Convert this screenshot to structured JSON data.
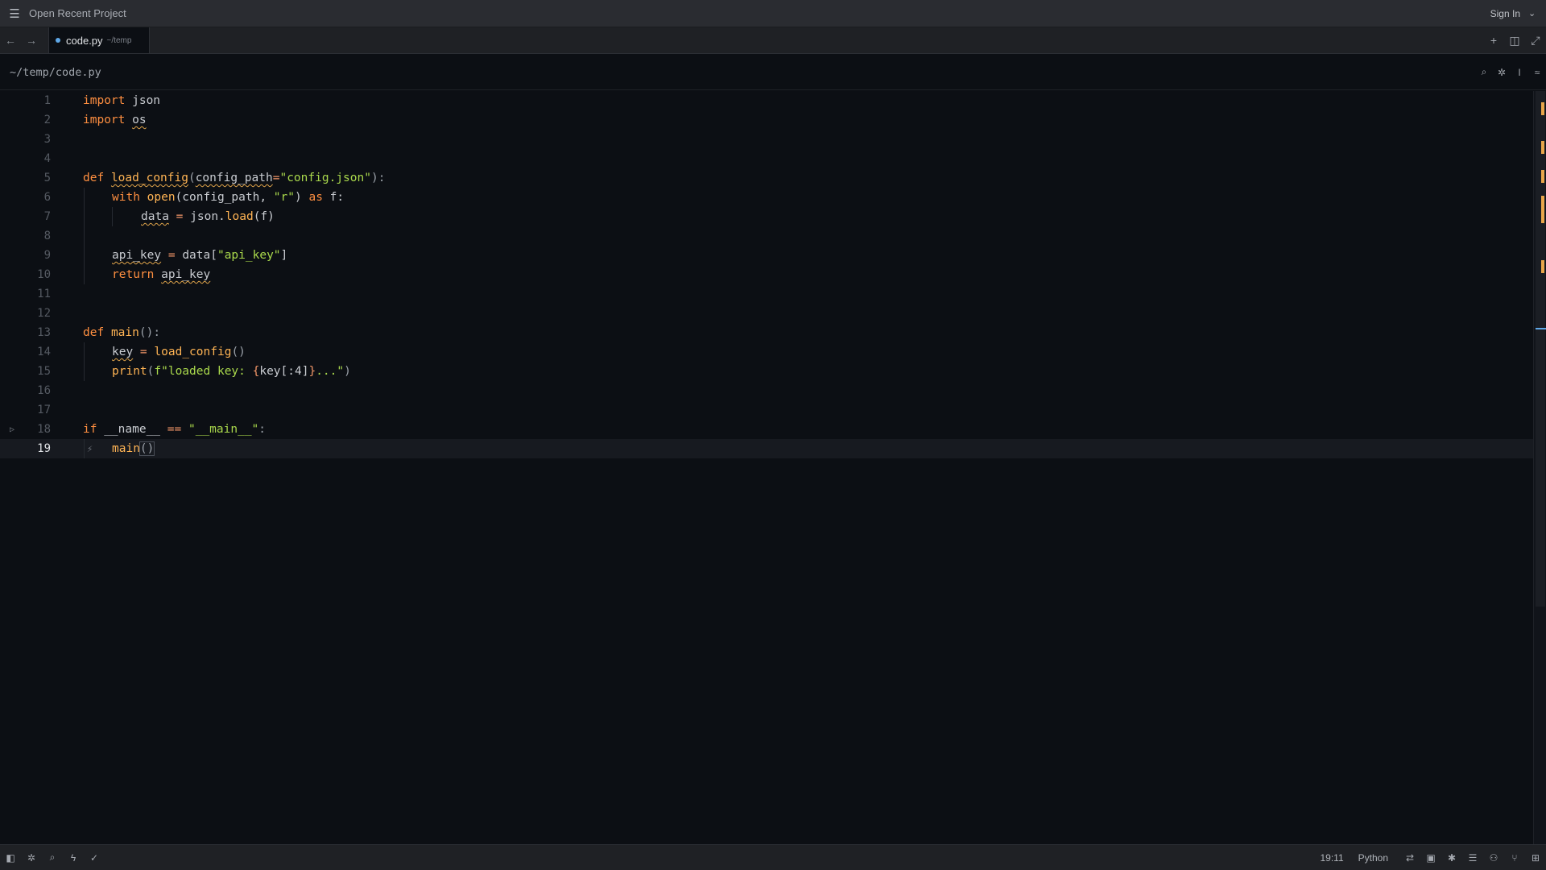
{
  "titlebar": {
    "project_label": "Open Recent Project",
    "signin_label": "Sign In"
  },
  "tab": {
    "name": "code.py",
    "dir": "~/temp"
  },
  "path": "~/temp/code.py",
  "status": {
    "position": "19:11",
    "language": "Python"
  },
  "colors": {
    "keyword": "#ff8f40",
    "function": "#ffb454",
    "string": "#aad94c",
    "accent": "#5fa8e8",
    "warning": "#e8a64a"
  },
  "icons": {
    "menu": "hamburger-menu-icon",
    "back": "arrow-left-icon",
    "forward": "arrow-right-icon",
    "new_tab": "plus-icon",
    "split": "split-pane-icon",
    "fullscreen": "expand-icon"
  },
  "code_lines": [
    {
      "n": "1"
    },
    {
      "n": "2"
    },
    {
      "n": "3"
    },
    {
      "n": "4"
    },
    {
      "n": "5"
    },
    {
      "n": "6"
    },
    {
      "n": "7"
    },
    {
      "n": "8"
    },
    {
      "n": "9"
    },
    {
      "n": "10"
    },
    {
      "n": "11"
    },
    {
      "n": "12"
    },
    {
      "n": "13"
    },
    {
      "n": "14"
    },
    {
      "n": "15"
    },
    {
      "n": "16"
    },
    {
      "n": "17"
    },
    {
      "n": "18"
    },
    {
      "n": "19"
    }
  ],
  "code": {
    "l1": {
      "kw": "import",
      "rest": " json"
    },
    "l2": {
      "kw": "import",
      "mod": "os"
    },
    "l5": {
      "kw": "def",
      "name": "load_config",
      "p1": "(",
      "param": "config_path",
      "eq": "=",
      "str": "\"config.json\"",
      "p2": "):"
    },
    "l6": {
      "kw": "with",
      "fn": "open",
      "a": "(config_path, ",
      "str": "\"r\"",
      "b": ") ",
      "kw2": "as",
      "c": " f:"
    },
    "l7": {
      "var": "data",
      "eq": " = ",
      "obj": "json.",
      "fn": "load",
      "args": "(f)"
    },
    "l9": {
      "var": "api_key",
      "eq": " = ",
      "obj": "data[",
      "str": "\"api_key\"",
      "close": "]"
    },
    "l10": {
      "kw": "return",
      "var": "api_key"
    },
    "l13": {
      "kw": "def",
      "name": "main",
      "rest": "():"
    },
    "l14": {
      "var": "key",
      "eq": " = ",
      "fn": "load_config",
      "args": "()"
    },
    "l15": {
      "fn": "print",
      "p1": "(",
      "str1": "f\"loaded key: ",
      "br1": "{",
      "expr": "key[:4]",
      "br2": "}",
      "str2": "...\"",
      "p2": ")"
    },
    "l18": {
      "kw": "if",
      "name": " __name__ ",
      "op": "==",
      "str": " \"__main__\"",
      "rest": ":"
    },
    "l19": {
      "fn": "main",
      "args": "()"
    }
  }
}
